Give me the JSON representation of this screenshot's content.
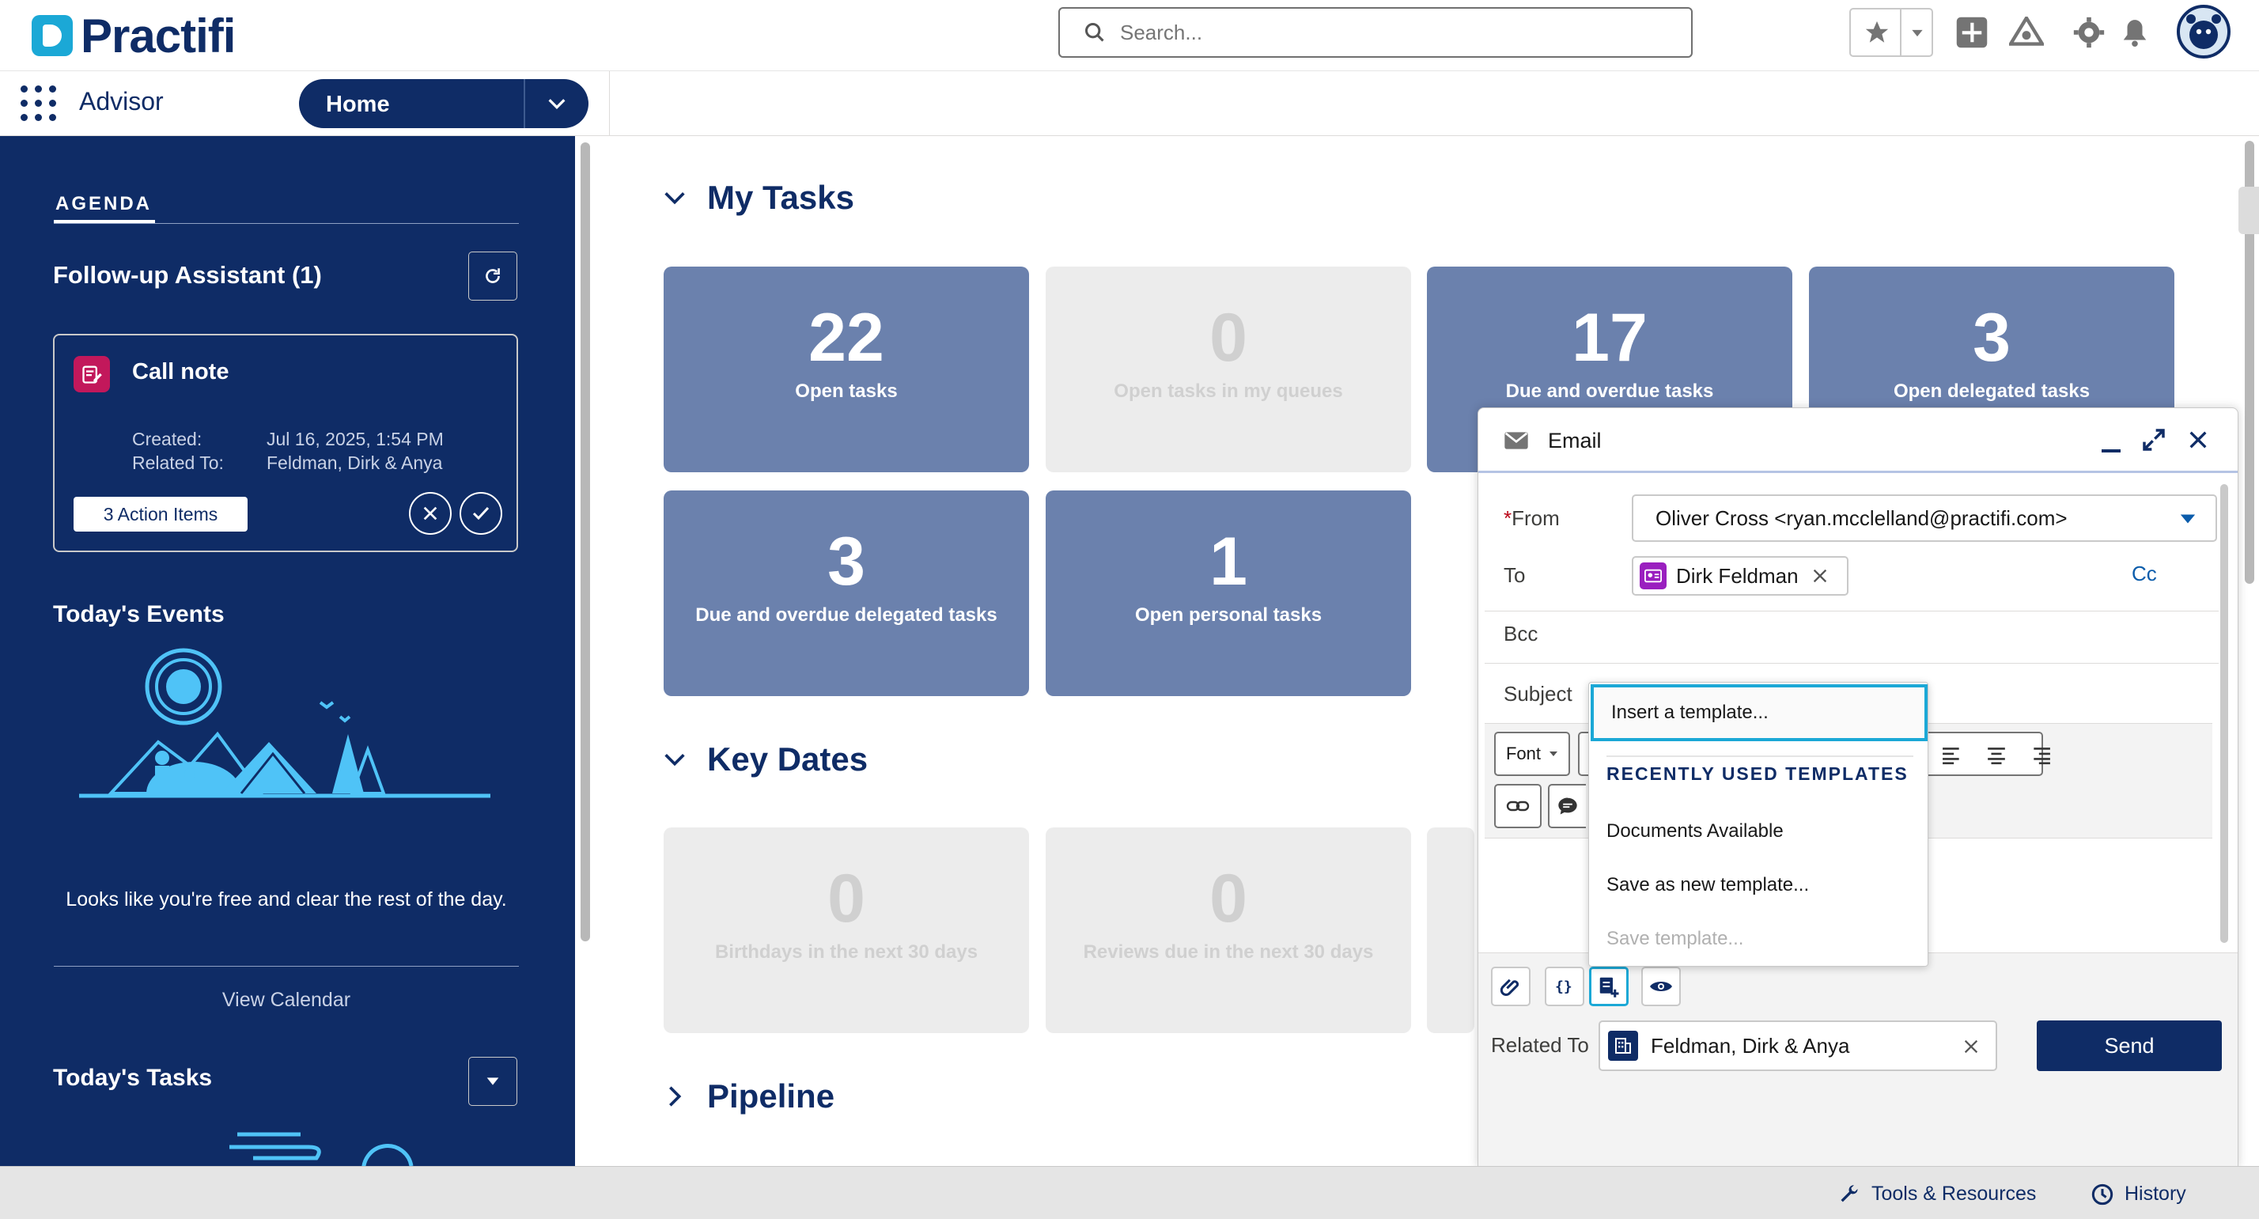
{
  "header": {
    "logo_text": "Practifi",
    "search_placeholder": "Search..."
  },
  "nav": {
    "app_name": "Advisor",
    "tab_label": "Home"
  },
  "sidebar": {
    "agenda_tab": "AGENDA",
    "follow_up_title": "Follow-up Assistant (1)",
    "call_note": {
      "title": "Call note",
      "created_label": "Created:",
      "created_value": "Jul 16, 2025, 1:54 PM",
      "related_label": "Related To:",
      "related_value": "Feldman, Dirk & Anya",
      "action_items": "3 Action Items"
    },
    "events_title": "Today's Events",
    "free_message": "Looks like you're free and clear the rest of the day.",
    "view_calendar": "View Calendar",
    "tasks_title": "Today's Tasks"
  },
  "main": {
    "my_tasks_title": "My Tasks",
    "task_tiles": [
      {
        "value": "22",
        "label": "Open tasks",
        "active": true
      },
      {
        "value": "0",
        "label": "Open tasks in my queues",
        "active": false
      },
      {
        "value": "17",
        "label": "Due and overdue tasks",
        "active": true
      },
      {
        "value": "3",
        "label": "Open delegated tasks",
        "active": true
      },
      {
        "value": "3",
        "label": "Due and overdue delegated tasks",
        "active": true
      },
      {
        "value": "1",
        "label": "Open personal tasks",
        "active": true
      }
    ],
    "key_dates_title": "Key Dates",
    "key_date_tiles": [
      {
        "value": "0",
        "label": "Birthdays in the next 30 days"
      },
      {
        "value": "0",
        "label": "Reviews due in the next 30 days"
      }
    ],
    "pipeline_title": "Pipeline"
  },
  "email": {
    "title": "Email",
    "from_label": "From",
    "from_value": "Oliver Cross <ryan.mcclelland@practifi.com>",
    "to_label": "To",
    "to_recipient": "Dirk Feldman",
    "cc_label": "Cc",
    "bcc_label": "Bcc",
    "subject_label": "Subject",
    "font_label": "Font",
    "related_label": "Related To",
    "related_value": "Feldman, Dirk & Anya",
    "send_label": "Send"
  },
  "template_menu": {
    "insert": "Insert a template...",
    "section_header": "RECENTLY USED TEMPLATES",
    "items": [
      "Documents Available",
      "Save as new template...",
      "Save template..."
    ]
  },
  "utility_bar": {
    "tools": "Tools & Resources",
    "history": "History"
  },
  "colors": {
    "brand_navy": "#0f2c66",
    "tile_active": "#6b81ad",
    "tile_inactive": "#ececec",
    "accent_blue": "#1ba8d6",
    "contact_purple": "#9a1fbf",
    "call_note_red": "#c2185b"
  }
}
